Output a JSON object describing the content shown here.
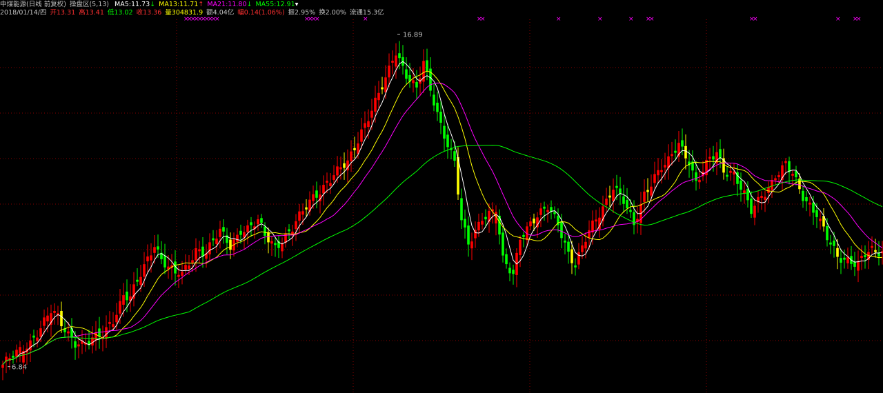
{
  "header": {
    "title": "中煤能源(日线 前复权)",
    "indicator": "操盘区(5,13)",
    "ma": [
      {
        "label": "MA5:11.73",
        "arrow": "↓",
        "color": "#ffffff",
        "arrow_color": "#00ff00"
      },
      {
        "label": "MA13:11.71",
        "arrow": "↑",
        "color": "#ffff00",
        "arrow_color": "#ff3030"
      },
      {
        "label": "MA21:11.80",
        "arrow": "↓",
        "color": "#ff00ff",
        "arrow_color": "#00ff00"
      },
      {
        "label": "MA55:12.91",
        "arrow": "▾",
        "color": "#00ff00",
        "arrow_color": "#ffffff"
      }
    ],
    "quote": [
      {
        "text": "2018/01/14/四",
        "color": "#c0c0c0"
      },
      {
        "text": "开13.31",
        "color": "#ff3030"
      },
      {
        "text": "高13.41",
        "color": "#ff3030"
      },
      {
        "text": "低13.02",
        "color": "#00ff00"
      },
      {
        "text": "收13.36",
        "color": "#ff3030"
      },
      {
        "text": "量304831.9",
        "color": "#ffff00"
      },
      {
        "text": "额4.04亿",
        "color": "#c0c0c0"
      },
      {
        "text": "幅0.14(1.06%)",
        "color": "#ff3030"
      },
      {
        "text": "振2.95%",
        "color": "#c0c0c0"
      },
      {
        "text": "换2.00%",
        "color": "#c0c0c0"
      },
      {
        "text": "流通15.3亿",
        "color": "#c0c0c0"
      }
    ]
  },
  "colors": {
    "up": "#ff0000",
    "down": "#00ff00",
    "warn": "#ffff00",
    "ma5": "#ffffff",
    "ma13": "#ffff00",
    "ma21": "#ff00ff",
    "ma55": "#00ff00",
    "grid": "#8b0000",
    "marker": "#ff00ff"
  },
  "chart_data": {
    "type": "candlestick",
    "y_range": [
      6.5,
      17.3
    ],
    "high_label": "16.89",
    "low_label": "6.84",
    "signal_marker": "×",
    "signal_groups": [
      [
        53,
        62
      ],
      [
        88,
        91
      ],
      [
        105,
        105
      ],
      [
        138,
        139
      ],
      [
        161,
        161
      ],
      [
        173,
        173
      ],
      [
        182,
        182
      ],
      [
        187,
        188
      ],
      [
        217,
        218
      ],
      [
        242,
        242
      ],
      [
        247,
        248
      ]
    ],
    "keypoints": [
      [
        0,
        6.9
      ],
      [
        5,
        7.3
      ],
      [
        8,
        7.6
      ],
      [
        12,
        8.2
      ],
      [
        14,
        8.5
      ],
      [
        17,
        8.1
      ],
      [
        21,
        7.6
      ],
      [
        24,
        7.5
      ],
      [
        29,
        7.8
      ],
      [
        32,
        8.3
      ],
      [
        35,
        9.0
      ],
      [
        37,
        8.9
      ],
      [
        40,
        9.6
      ],
      [
        44,
        10.6
      ],
      [
        46,
        10.1
      ],
      [
        50,
        9.6
      ],
      [
        52,
        9.6
      ],
      [
        56,
        10.4
      ],
      [
        59,
        10.3
      ],
      [
        63,
        10.9
      ],
      [
        66,
        10.5
      ],
      [
        69,
        11.0
      ],
      [
        71,
        11.0
      ],
      [
        74,
        11.2
      ],
      [
        76,
        10.8
      ],
      [
        79,
        10.5
      ],
      [
        84,
        11.0
      ],
      [
        90,
        12.0
      ],
      [
        95,
        12.5
      ],
      [
        100,
        13.0
      ],
      [
        104,
        14.0
      ],
      [
        108,
        14.8
      ],
      [
        111,
        15.5
      ],
      [
        114,
        16.4
      ],
      [
        117,
        15.7
      ],
      [
        120,
        15.2
      ],
      [
        122,
        16.0
      ],
      [
        124,
        15.2
      ],
      [
        127,
        14.2
      ],
      [
        129,
        13.6
      ],
      [
        131,
        13.0
      ],
      [
        133,
        11.2
      ],
      [
        135,
        10.5
      ],
      [
        139,
        11.4
      ],
      [
        143,
        11.6
      ],
      [
        145,
        10.0
      ],
      [
        148,
        9.6
      ],
      [
        150,
        10.8
      ],
      [
        153,
        11.2
      ],
      [
        158,
        11.6
      ],
      [
        161,
        11.2
      ],
      [
        164,
        10.3
      ],
      [
        166,
        9.9
      ],
      [
        170,
        10.9
      ],
      [
        173,
        11.5
      ],
      [
        177,
        12.3
      ],
      [
        180,
        11.8
      ],
      [
        183,
        11.1
      ],
      [
        186,
        12.1
      ],
      [
        189,
        12.6
      ],
      [
        193,
        13.0
      ],
      [
        196,
        13.6
      ],
      [
        199,
        13.1
      ],
      [
        201,
        12.4
      ],
      [
        204,
        12.9
      ],
      [
        207,
        13.3
      ],
      [
        209,
        12.8
      ],
      [
        212,
        12.7
      ],
      [
        215,
        12.0
      ],
      [
        217,
        11.5
      ],
      [
        220,
        12.0
      ],
      [
        224,
        12.6
      ],
      [
        227,
        12.9
      ],
      [
        229,
        12.6
      ],
      [
        232,
        12.0
      ],
      [
        236,
        11.5
      ],
      [
        239,
        10.7
      ],
      [
        242,
        10.1
      ],
      [
        245,
        10.1
      ],
      [
        248,
        10.0
      ],
      [
        251,
        10.3
      ],
      [
        253,
        10.2
      ],
      [
        255,
        10.3
      ]
    ],
    "up_bar_indices": [
      6,
      8,
      12,
      14,
      30,
      32,
      35,
      40,
      44,
      54,
      56,
      63,
      68,
      71,
      84,
      90,
      96,
      100,
      104,
      108,
      111,
      114,
      122,
      139,
      143,
      153,
      158,
      170,
      173,
      177,
      186,
      189,
      193,
      196,
      204,
      207,
      220,
      224,
      251,
      255
    ]
  }
}
